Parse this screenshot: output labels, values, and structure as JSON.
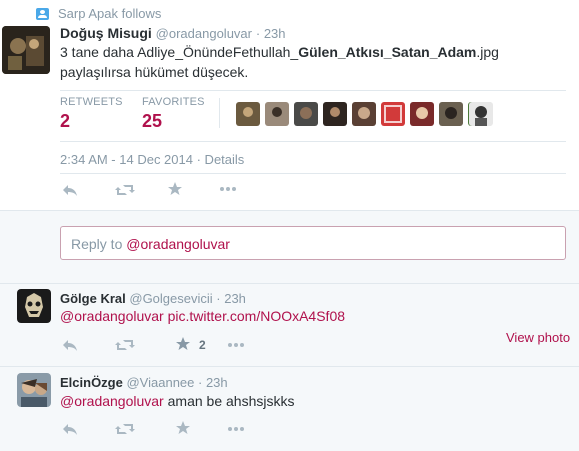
{
  "notification": {
    "text": "Sarp Apak follows"
  },
  "main_tweet": {
    "name": "Doğuş Misugi",
    "handle": "@oradangoluvar",
    "time": "· 23h",
    "text_line1_pre": "3 tane daha Adliye_ÖnündeFethullah_",
    "text_line1_bold": "Gülen_Atkısı_Satan_Adam",
    "text_line1_post": ".jpg",
    "text_line2": "paylaşılırsa hükümet düşecek.",
    "retweets_label": "RETWEETS",
    "retweets": "2",
    "favorites_label": "FAVORITES",
    "favorites": "25",
    "timestamp": "2:34 AM - 14 Dec 2014",
    "details": "· Details"
  },
  "actions": {
    "reply_icon": "reply-icon",
    "retweet_icon": "retweet-icon",
    "favorite_icon": "favorite-icon",
    "more_icon": "more-icon"
  },
  "reply_box": {
    "prefix": "Reply to ",
    "handle": "@oradangoluvar"
  },
  "replies": [
    {
      "name": "Gölge Kral",
      "handle": "@Golgesevicii",
      "time": "· 23h",
      "mention": "@oradangoluvar",
      "link": "pic.twitter.com/NOOxA4Sf08",
      "view_photo": "View photo",
      "fav_count": "2"
    },
    {
      "name": "ElcinÖzge",
      "handle": "@Viaannee",
      "time": "· 23h",
      "mention": "@oradangoluvar",
      "text": " aman be ahshsjskks"
    }
  ],
  "colors": {
    "accent": "#b0114c",
    "muted": "#8899a6",
    "border": "#e1e8ed",
    "bg": "#f5f8fa"
  }
}
